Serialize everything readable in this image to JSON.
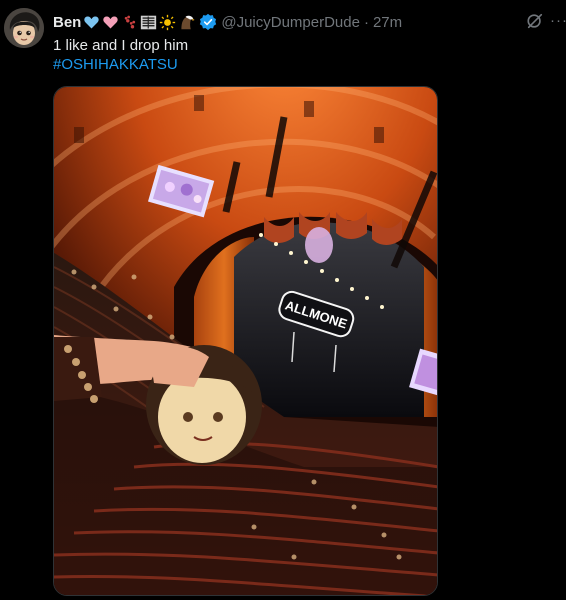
{
  "tweet": {
    "display_name": "Ben",
    "name_emojis": [
      "blue-heart-icon",
      "pink-heart-icon",
      "paw-prints-icon",
      "glyph-tile-icon",
      "sun-icon",
      "eagle-icon"
    ],
    "verified_icon": "verified-badge-icon",
    "handle": "@JuicyDumperDude",
    "separator": "·",
    "time": "27m",
    "text": "1 like and I drop him",
    "hashtag": "#OSHIHAKKATSU",
    "grok_icon": "grok-icon",
    "more_label": "···",
    "media": {
      "description_icon": "concert-hall-photo",
      "marquee_text": "ALLMONE"
    }
  },
  "colors": {
    "background": "#000000",
    "text": "#e7e9ea",
    "muted": "#71767b",
    "link": "#1d9bf0",
    "verified": "#1d9bf0"
  }
}
